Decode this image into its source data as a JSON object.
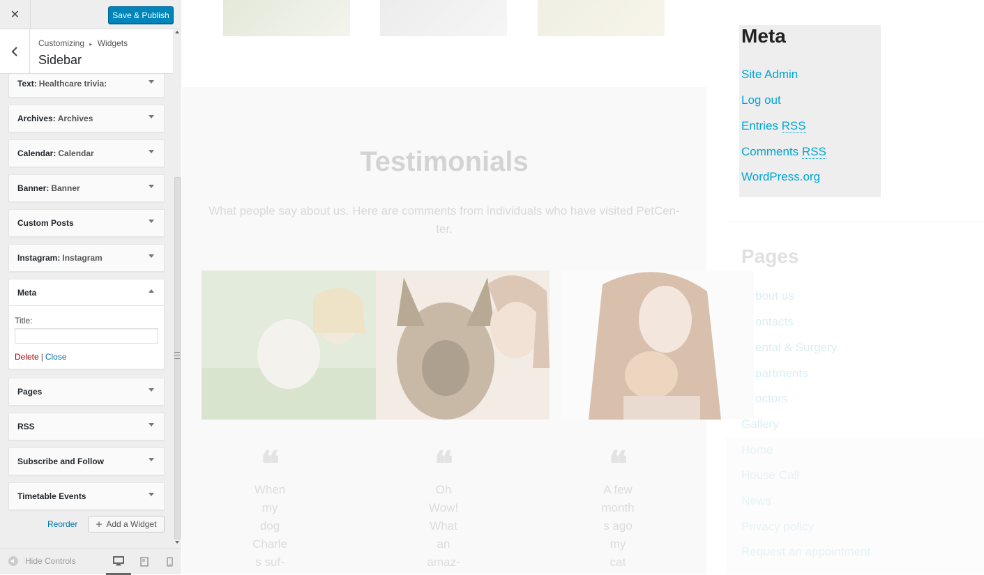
{
  "topbar": {
    "close_label": "✕",
    "save_label": "Save & Publish"
  },
  "section": {
    "crumb_root": "Customizing",
    "crumb_sep": "▸",
    "crumb_current": "Widgets",
    "title": "Sidebar"
  },
  "widgets": [
    {
      "type": "Text",
      "title": "Healthcare trivia:"
    },
    {
      "type": "Archives",
      "title": "Archives"
    },
    {
      "type": "Calendar",
      "title": "Calendar"
    },
    {
      "type": "Banner",
      "title": "Banner"
    },
    {
      "type": "Custom Posts",
      "title": ""
    },
    {
      "type": "Instagram",
      "title": "Instagram"
    },
    {
      "type": "Meta",
      "title": ""
    },
    {
      "type": "Pages",
      "title": ""
    },
    {
      "type": "RSS",
      "title": ""
    },
    {
      "type": "Subscribe and Follow",
      "title": ""
    },
    {
      "type": "Timetable Events",
      "title": ""
    }
  ],
  "meta_form": {
    "title_label": "Title:",
    "title_value": "",
    "delete_label": "Delete",
    "separator": "|",
    "close_label": "Close"
  },
  "actions": {
    "reorder_label": "Reorder",
    "add_widget_label": "Add a Widget"
  },
  "footer": {
    "hide_controls_label": "Hide Controls",
    "active_device": "desktop"
  },
  "preview": {
    "testimonials_title": "Testimonials",
    "testimonials_subtitle": "What people say about us. Here are comments from individuals who have visited PetCen-ter.",
    "quotes": [
      [
        "When",
        "my",
        "dog",
        "Charle",
        "s suf-"
      ],
      [
        "Oh",
        "Wow!",
        "What",
        "an",
        "amaz-"
      ],
      [
        "A few",
        "month",
        "s ago",
        "my",
        "cat"
      ]
    ],
    "meta": {
      "title": "Meta",
      "links": [
        {
          "text": "Site Admin",
          "abbr": ""
        },
        {
          "text": "Log out",
          "abbr": ""
        },
        {
          "text": "Entries ",
          "abbr": "RSS"
        },
        {
          "text": "Comments ",
          "abbr": "RSS"
        },
        {
          "text": "WordPress.org",
          "abbr": ""
        }
      ]
    },
    "pages": {
      "title": "Pages",
      "links": [
        "bout us",
        "ontacts",
        "ental & Surgery",
        "partments",
        "octors",
        "Gallery",
        "Home",
        "House Call",
        "News",
        "Privacy policy",
        "Request an appointment"
      ]
    }
  },
  "colors": {
    "primary": "#0085ba",
    "link": "#0073aa",
    "delete": "#a00000",
    "meta_link": "#00a6d2"
  }
}
